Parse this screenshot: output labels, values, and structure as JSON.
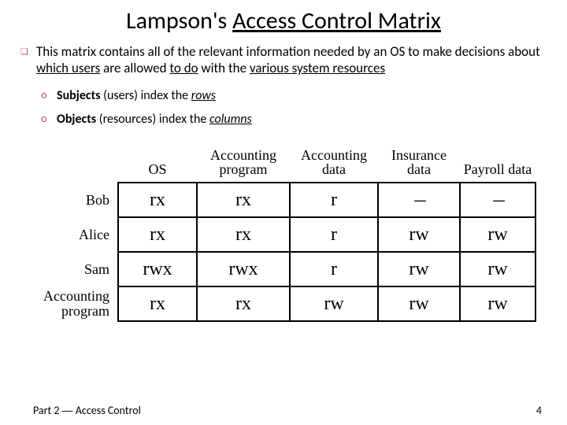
{
  "title": {
    "prefix": "Lampson's ",
    "main": "Access Control Matrix"
  },
  "bullets": {
    "top": {
      "pre": "This matrix contains all of the relevant information needed by an OS to make decisions about ",
      "u1": "which users",
      "mid1": " are allowed ",
      "u2": "to do",
      "mid2": " with the ",
      "u3": "various system resources"
    },
    "sub1": {
      "bold": "Subjects",
      "middle": " (users) index the ",
      "ital": "rows"
    },
    "sub2": {
      "bold": "Objects",
      "middle": " (resources) index the ",
      "ital": "columns"
    }
  },
  "matrix": {
    "col_headers": [
      "OS",
      "Accounting program",
      "Accounting data",
      "Insurance data",
      "Payroll data"
    ],
    "row_headers": [
      "Bob",
      "Alice",
      "Sam",
      "Accounting program"
    ],
    "cells": [
      [
        "rx",
        "rx",
        "r",
        "—",
        "—"
      ],
      [
        "rx",
        "rx",
        "r",
        "rw",
        "rw"
      ],
      [
        "rwx",
        "rwx",
        "r",
        "rw",
        "rw"
      ],
      [
        "rx",
        "rx",
        "rw",
        "rw",
        "rw"
      ]
    ]
  },
  "footer": {
    "left_pre": "Part 2 ",
    "left_sep": "—",
    "left_post": " Access Control",
    "pagenum": "4"
  }
}
